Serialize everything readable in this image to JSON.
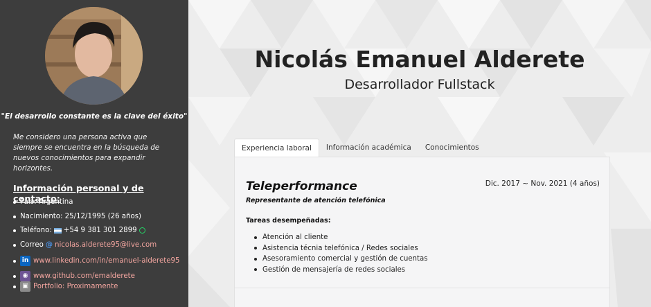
{
  "sidebar": {
    "quote": "\"El desarrollo constante es la clave del éxito\"",
    "bio": "Me considero una persona activa que siempre se encuentra en la búsqueda de nuevos conocimientos para expandir horizontes.",
    "contact_heading": "Información personal y de contacto:",
    "contact": {
      "country": "País: Argentina",
      "birth": "Nacimiento: 25/12/1995 (26 años)",
      "phone_label": "Teléfono:",
      "phone_value": "+54 9 381 301 2899",
      "email_label": "Correo",
      "email_value": "nicolas.alderete95@live.com",
      "linkedin": "www.linkedin.com/in/emanuel-alderete95",
      "github": "www.github.com/emalderete",
      "portfolio": "Portfolio: Proximamente"
    }
  },
  "header": {
    "name": "Nicolás Emanuel Alderete",
    "title": "Desarrollador Fullstack"
  },
  "tabs": [
    {
      "label": "Experiencia laboral",
      "active": true
    },
    {
      "label": "Información académica",
      "active": false
    },
    {
      "label": "Conocimientos",
      "active": false
    }
  ],
  "experience": {
    "company": "Teleperformance",
    "dates": "Dic. 2017 ~ Nov. 2021 (4 años)",
    "role": "Representante de atención telefónica",
    "tasks_heading": "Tareas desempeñadas:",
    "tasks": [
      "Atención al cliente",
      "Asistencia técnia telefónica / Redes sociales",
      "Asesoramiento comercial y gestión de cuentas",
      "Gestión de mensajería de redes sociales"
    ]
  },
  "colors": {
    "sidebar_bg": "#3d3d3d",
    "link": "#f4a6a0",
    "linkedin": "#0a66c2",
    "github": "#6e5494",
    "whatsapp": "#25d366"
  },
  "icons": [
    "argentina-flag-icon",
    "whatsapp-icon",
    "at-icon",
    "linkedin-icon",
    "github-icon",
    "briefcase-icon"
  ]
}
